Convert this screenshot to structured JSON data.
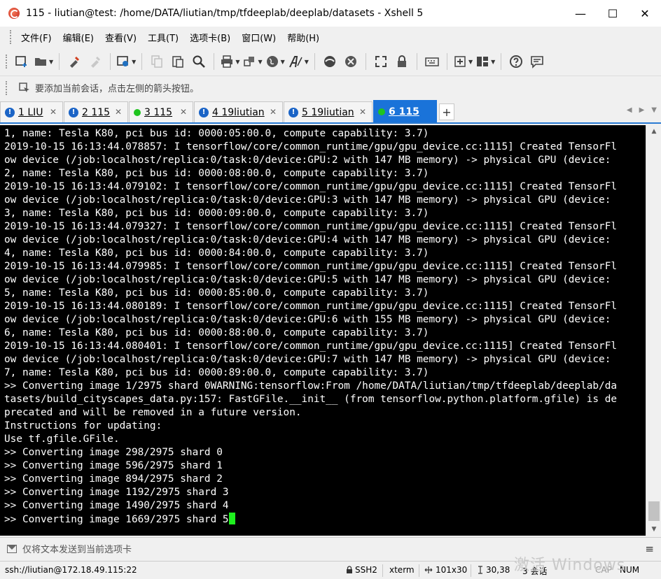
{
  "window": {
    "title": "115 - liutian@test: /home/DATA/liutian/tmp/tfdeeplab/deeplab/datasets - Xshell 5",
    "minimize": "—",
    "maximize": "☐",
    "close": "✕"
  },
  "menu": {
    "items": [
      "文件(F)",
      "编辑(E)",
      "查看(V)",
      "工具(T)",
      "选项卡(B)",
      "窗口(W)",
      "帮助(H)"
    ]
  },
  "toolbar": {
    "icons": [
      "new-session-icon",
      "open-folder-icon",
      "reconnect-icon",
      "disconnect-icon",
      "properties-icon",
      "copy-icon",
      "paste-icon",
      "find-icon",
      "print-icon",
      "transfer-icon",
      "globe-icon",
      "font-icon",
      "xftp-icon",
      "xmanager-icon",
      "fullscreen-icon",
      "lock-icon",
      "keyboard-icon",
      "add-icon",
      "layout-icon",
      "help-icon",
      "chat-icon"
    ]
  },
  "hint": {
    "text": "要添加当前会话，点击左侧的箭头按钮。"
  },
  "tabs": [
    {
      "badge": "!",
      "label": "1 LIU",
      "active": false
    },
    {
      "badge": "!",
      "label": "2 115",
      "active": false
    },
    {
      "badge": "",
      "label": "3 115",
      "active": false,
      "connected": true
    },
    {
      "badge": "!",
      "label": "4 19liutian",
      "active": false
    },
    {
      "badge": "!",
      "label": "5 19liutian",
      "active": false
    },
    {
      "badge": "",
      "label": "6 115",
      "active": true,
      "connected": true
    }
  ],
  "tab_add": "+",
  "tab_close": "✕",
  "tab_nav": {
    "prev": "◀",
    "next": "▶",
    "menu": "▼"
  },
  "terminal": {
    "lines": [
      "1, name: Tesla K80, pci bus id: 0000:05:00.0, compute capability: 3.7)",
      "2019-10-15 16:13:44.078857: I tensorflow/core/common_runtime/gpu/gpu_device.cc:1115] Created TensorFl",
      "ow device (/job:localhost/replica:0/task:0/device:GPU:2 with 147 MB memory) -> physical GPU (device:",
      "2, name: Tesla K80, pci bus id: 0000:08:00.0, compute capability: 3.7)",
      "2019-10-15 16:13:44.079102: I tensorflow/core/common_runtime/gpu/gpu_device.cc:1115] Created TensorFl",
      "ow device (/job:localhost/replica:0/task:0/device:GPU:3 with 147 MB memory) -> physical GPU (device:",
      "3, name: Tesla K80, pci bus id: 0000:09:00.0, compute capability: 3.7)",
      "2019-10-15 16:13:44.079327: I tensorflow/core/common_runtime/gpu/gpu_device.cc:1115] Created TensorFl",
      "ow device (/job:localhost/replica:0/task:0/device:GPU:4 with 147 MB memory) -> physical GPU (device:",
      "4, name: Tesla K80, pci bus id: 0000:84:00.0, compute capability: 3.7)",
      "2019-10-15 16:13:44.079985: I tensorflow/core/common_runtime/gpu/gpu_device.cc:1115] Created TensorFl",
      "ow device (/job:localhost/replica:0/task:0/device:GPU:5 with 147 MB memory) -> physical GPU (device:",
      "5, name: Tesla K80, pci bus id: 0000:85:00.0, compute capability: 3.7)",
      "2019-10-15 16:13:44.080189: I tensorflow/core/common_runtime/gpu/gpu_device.cc:1115] Created TensorFl",
      "ow device (/job:localhost/replica:0/task:0/device:GPU:6 with 155 MB memory) -> physical GPU (device:",
      "6, name: Tesla K80, pci bus id: 0000:88:00.0, compute capability: 3.7)",
      "2019-10-15 16:13:44.080401: I tensorflow/core/common_runtime/gpu/gpu_device.cc:1115] Created TensorFl",
      "ow device (/job:localhost/replica:0/task:0/device:GPU:7 with 147 MB memory) -> physical GPU (device:",
      "7, name: Tesla K80, pci bus id: 0000:89:00.0, compute capability: 3.7)",
      ">> Converting image 1/2975 shard 0WARNING:tensorflow:From /home/DATA/liutian/tmp/tfdeeplab/deeplab/da",
      "tasets/build_cityscapes_data.py:157: FastGFile.__init__ (from tensorflow.python.platform.gfile) is de",
      "precated and will be removed in a future version.",
      "Instructions for updating:",
      "Use tf.gfile.GFile.",
      ">> Converting image 298/2975 shard 0",
      ">> Converting image 596/2975 shard 1",
      ">> Converting image 894/2975 shard 2",
      ">> Converting image 1192/2975 shard 3",
      ">> Converting image 1490/2975 shard 4",
      ">> Converting image 1669/2975 shard 5"
    ],
    "cursor_color": "#1ef01e"
  },
  "sendbar": {
    "text": "仅将文本发送到当前选项卡",
    "menu": "≡"
  },
  "status": {
    "connection": "ssh://liutian@172.18.49.115:22",
    "protocol": "SSH2",
    "term": "xterm",
    "size": "101x30",
    "position": "30,38",
    "sessions": "3 会话",
    "cap": "CAP",
    "num": "NUM"
  },
  "watermark": "激活 Windows",
  "colors": {
    "terminal_bg": "#000000",
    "terminal_fg": "#ffffff",
    "active_tab": "#1a73d9",
    "tab_badge": "#1b64c6",
    "connected_dot": "#1fc41f"
  }
}
